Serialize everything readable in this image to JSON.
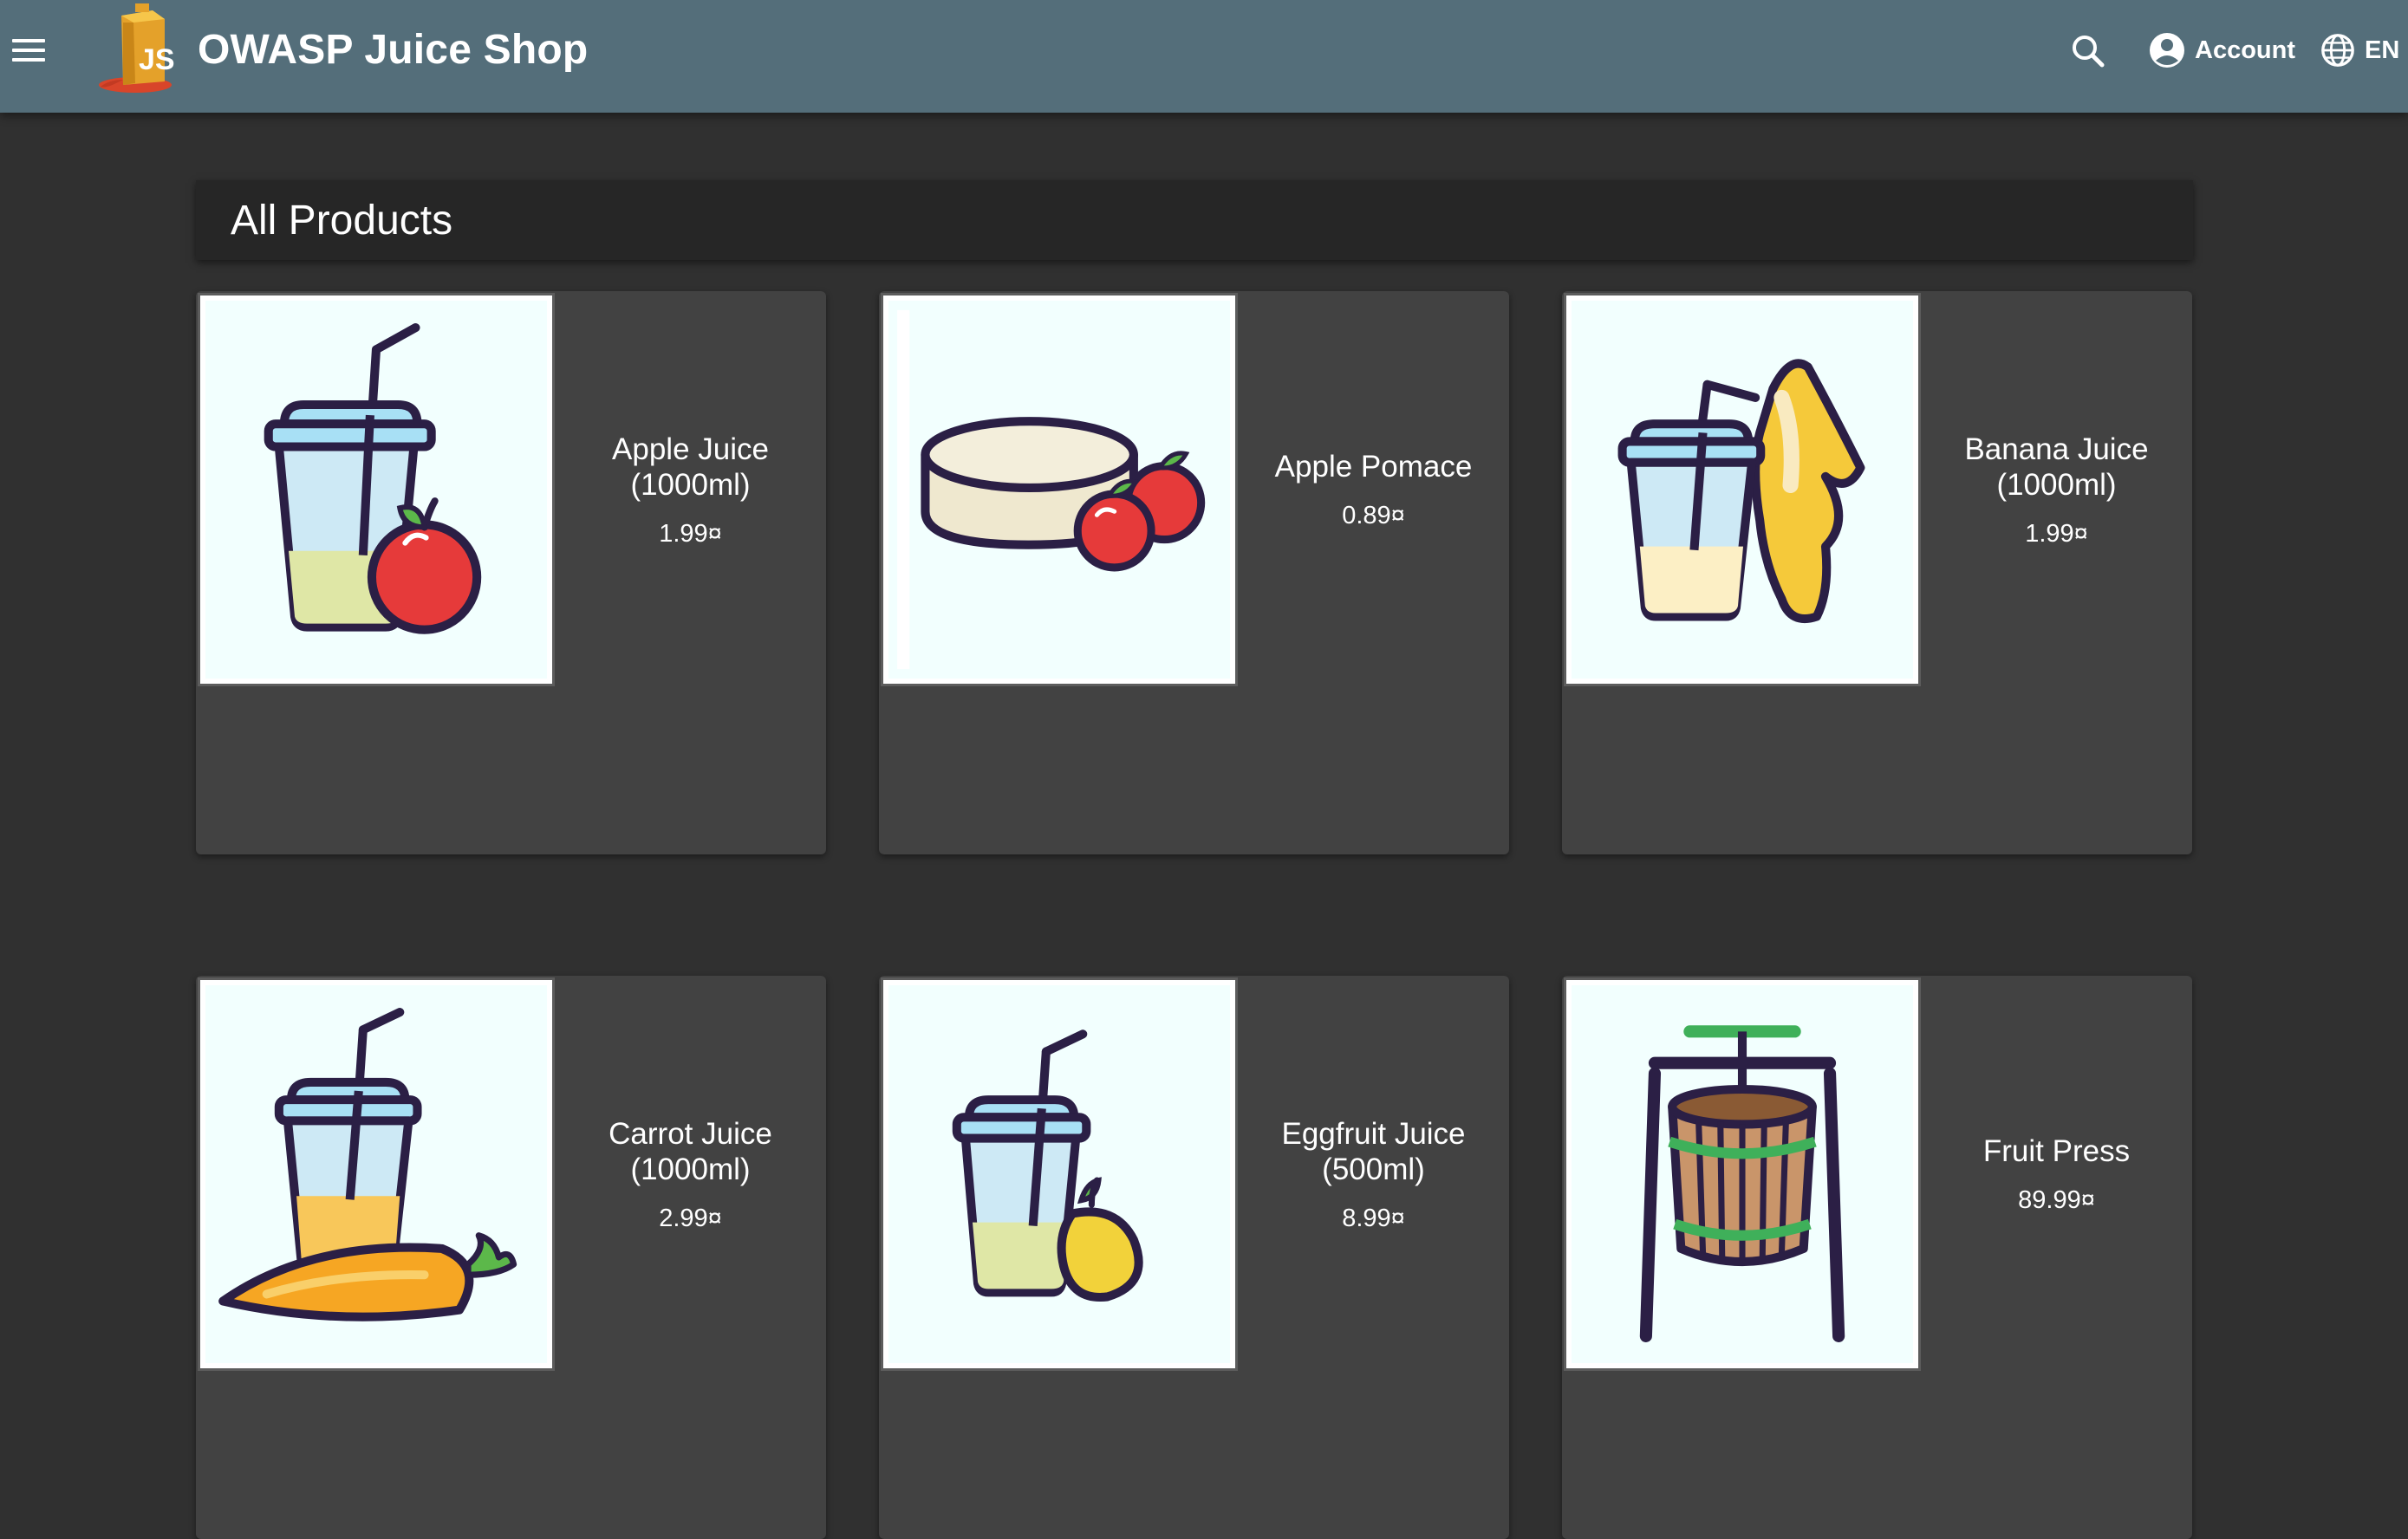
{
  "app": {
    "title": "OWASP Juice Shop",
    "account_label": "Account",
    "language_label": "EN"
  },
  "colors": {
    "toolbar": "#546e7a",
    "background": "#303030",
    "card": "#424242",
    "heading_bar": "#262626"
  },
  "page": {
    "heading": "All Products"
  },
  "products": [
    {
      "name": "Apple Juice (1000ml)",
      "price": "1.99¤",
      "icon": "apple-juice-icon"
    },
    {
      "name": "Apple Pomace",
      "price": "0.89¤",
      "icon": "apple-pomace-icon"
    },
    {
      "name": "Banana Juice (1000ml)",
      "price": "1.99¤",
      "icon": "banana-juice-icon"
    },
    {
      "name": "Carrot Juice (1000ml)",
      "price": "2.99¤",
      "icon": "carrot-juice-icon"
    },
    {
      "name": "Eggfruit Juice (500ml)",
      "price": "8.99¤",
      "icon": "eggfruit-juice-icon"
    },
    {
      "name": "Fruit Press",
      "price": "89.99¤",
      "icon": "fruit-press-icon"
    }
  ]
}
